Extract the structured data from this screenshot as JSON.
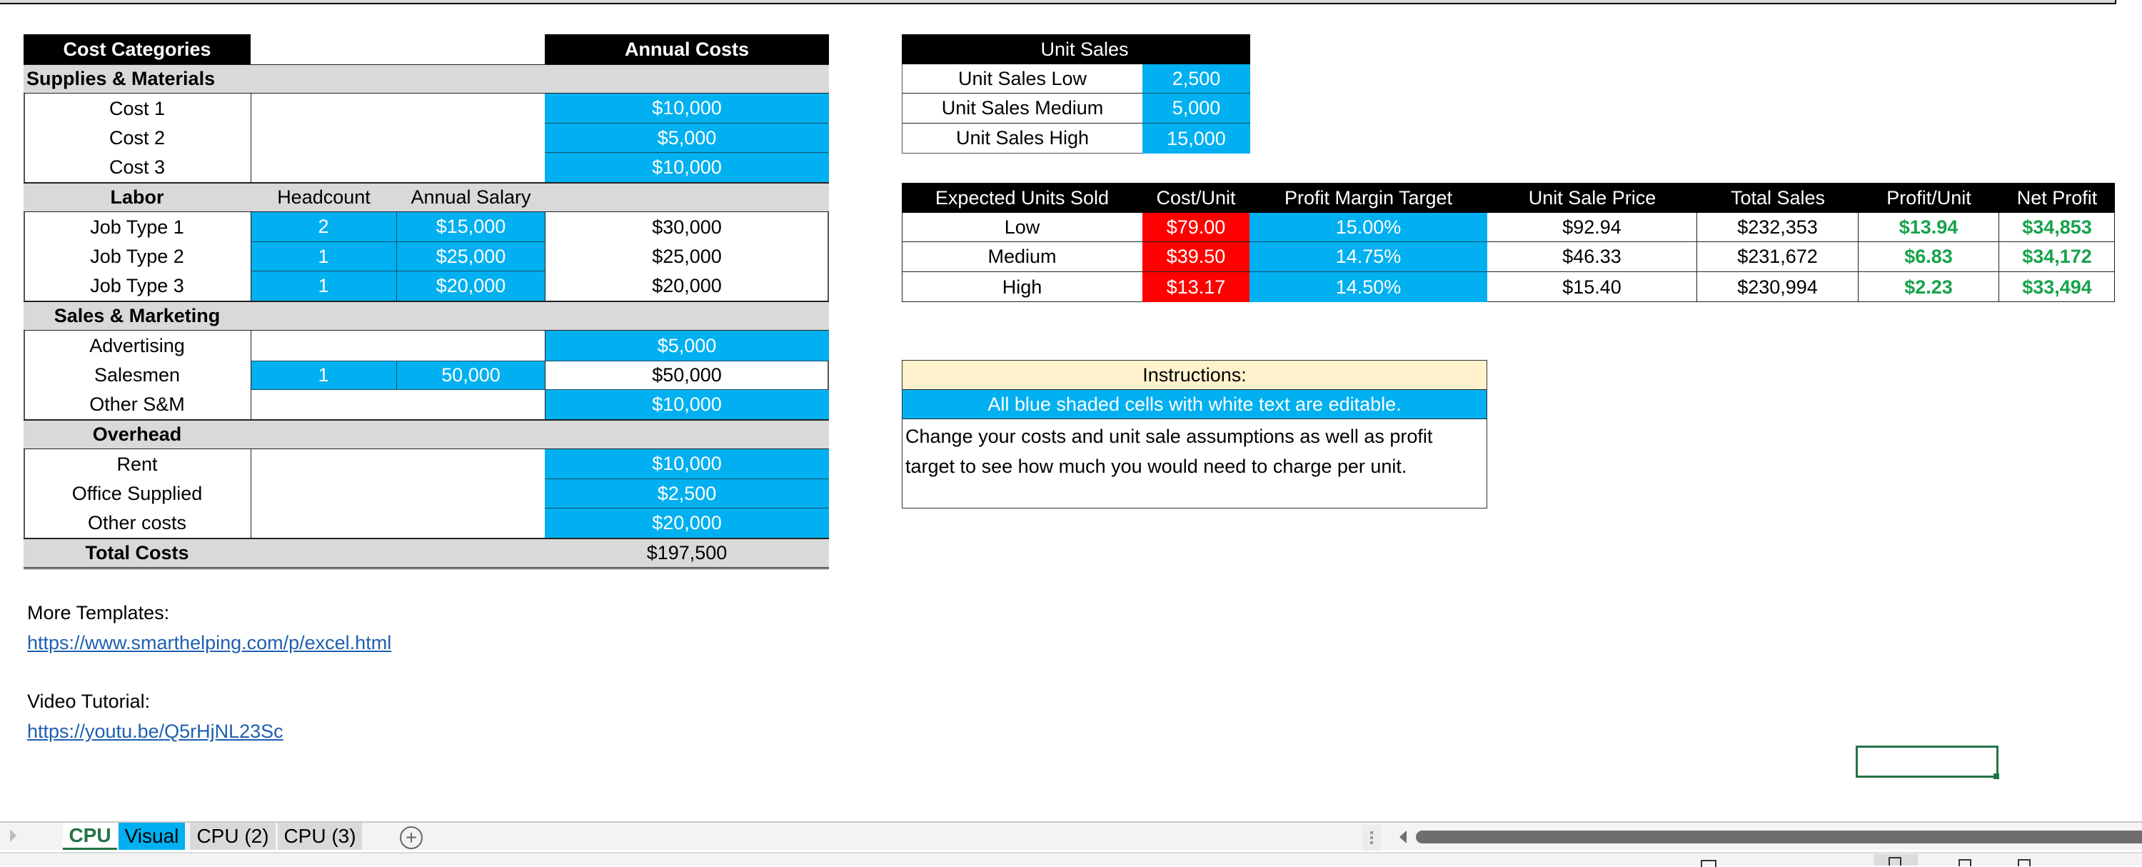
{
  "cost_table": {
    "header": {
      "category": "Cost Categories",
      "annual": "Annual Costs"
    },
    "supplies": {
      "title": "Supplies & Materials",
      "rows": [
        {
          "label": "Cost 1",
          "annual": "$10,000"
        },
        {
          "label": "Cost 2",
          "annual": "$5,000"
        },
        {
          "label": "Cost 3",
          "annual": "$10,000"
        }
      ]
    },
    "labor": {
      "title": "Labor",
      "headcount_label": "Headcount",
      "salary_label": "Annual Salary",
      "rows": [
        {
          "label": "Job Type 1",
          "headcount": "2",
          "salary": "$15,000",
          "annual": "$30,000"
        },
        {
          "label": "Job Type 2",
          "headcount": "1",
          "salary": "$25,000",
          "annual": "$25,000"
        },
        {
          "label": "Job Type 3",
          "headcount": "1",
          "salary": "$20,000",
          "annual": "$20,000"
        }
      ]
    },
    "sales_marketing": {
      "title": "Sales & Marketing",
      "advertising": {
        "label": "Advertising",
        "annual": "$5,000"
      },
      "salesmen": {
        "label": "Salesmen",
        "headcount": "1",
        "salary": "50,000",
        "annual": "$50,000"
      },
      "other": {
        "label": "Other S&M",
        "annual": "$10,000"
      }
    },
    "overhead": {
      "title": "Overhead",
      "rows": [
        {
          "label": "Rent",
          "annual": "$10,000"
        },
        {
          "label": "Office Supplied",
          "annual": "$2,500"
        },
        {
          "label": "Other costs",
          "annual": "$20,000"
        }
      ]
    },
    "total": {
      "label": "Total Costs",
      "value": "$197,500"
    }
  },
  "unit_sales": {
    "title": "Unit Sales",
    "rows": [
      {
        "label": "Unit Sales Low",
        "value": "2,500"
      },
      {
        "label": "Unit Sales Medium",
        "value": "5,000"
      },
      {
        "label": "Unit Sales High",
        "value": "15,000"
      }
    ]
  },
  "pricing": {
    "headers": [
      "Expected Units Sold",
      "Cost/Unit",
      "Profit Margin Target",
      "Unit Sale Price",
      "Total Sales",
      "Profit/Unit",
      "Net Profit"
    ],
    "rows": [
      {
        "scenario": "Low",
        "cost_unit": "$79.00",
        "margin": "15.00%",
        "price": "$92.94",
        "total_sales": "$232,353",
        "profit_unit": "$13.94",
        "net_profit": "$34,853"
      },
      {
        "scenario": "Medium",
        "cost_unit": "$39.50",
        "margin": "14.75%",
        "price": "$46.33",
        "total_sales": "$231,672",
        "profit_unit": "$6.83",
        "net_profit": "$34,172"
      },
      {
        "scenario": "High",
        "cost_unit": "$13.17",
        "margin": "14.50%",
        "price": "$15.40",
        "total_sales": "$230,994",
        "profit_unit": "$2.23",
        "net_profit": "$33,494"
      }
    ]
  },
  "instructions": {
    "title": "Instructions:",
    "editable_note": "All blue shaded cells with white text are editable.",
    "body_line1": "Change your costs and unit sale assumptions as well as profit",
    "body_line2": "target to see how much you would need to charge per unit."
  },
  "links": {
    "templates_label": "More Templates:",
    "templates_url": "https://www.smarthelping.com/p/excel.html",
    "video_label": "Video Tutorial:",
    "video_url": "https://youtu.be/Q5rHjNL23Sc"
  },
  "sheet_tabs": [
    {
      "label": "CPU",
      "active": true
    },
    {
      "label": "Visual",
      "color": "#00b0f0"
    },
    {
      "label": "CPU (2)"
    },
    {
      "label": "CPU (3)"
    }
  ],
  "colors": {
    "editable_blue": "#00b0f0",
    "cost_red": "#ff0000",
    "profit_green": "#16a34a",
    "section_gray": "#d9d9d9",
    "instructions_cream": "#fff2cc",
    "active_tab_green": "#217346"
  }
}
